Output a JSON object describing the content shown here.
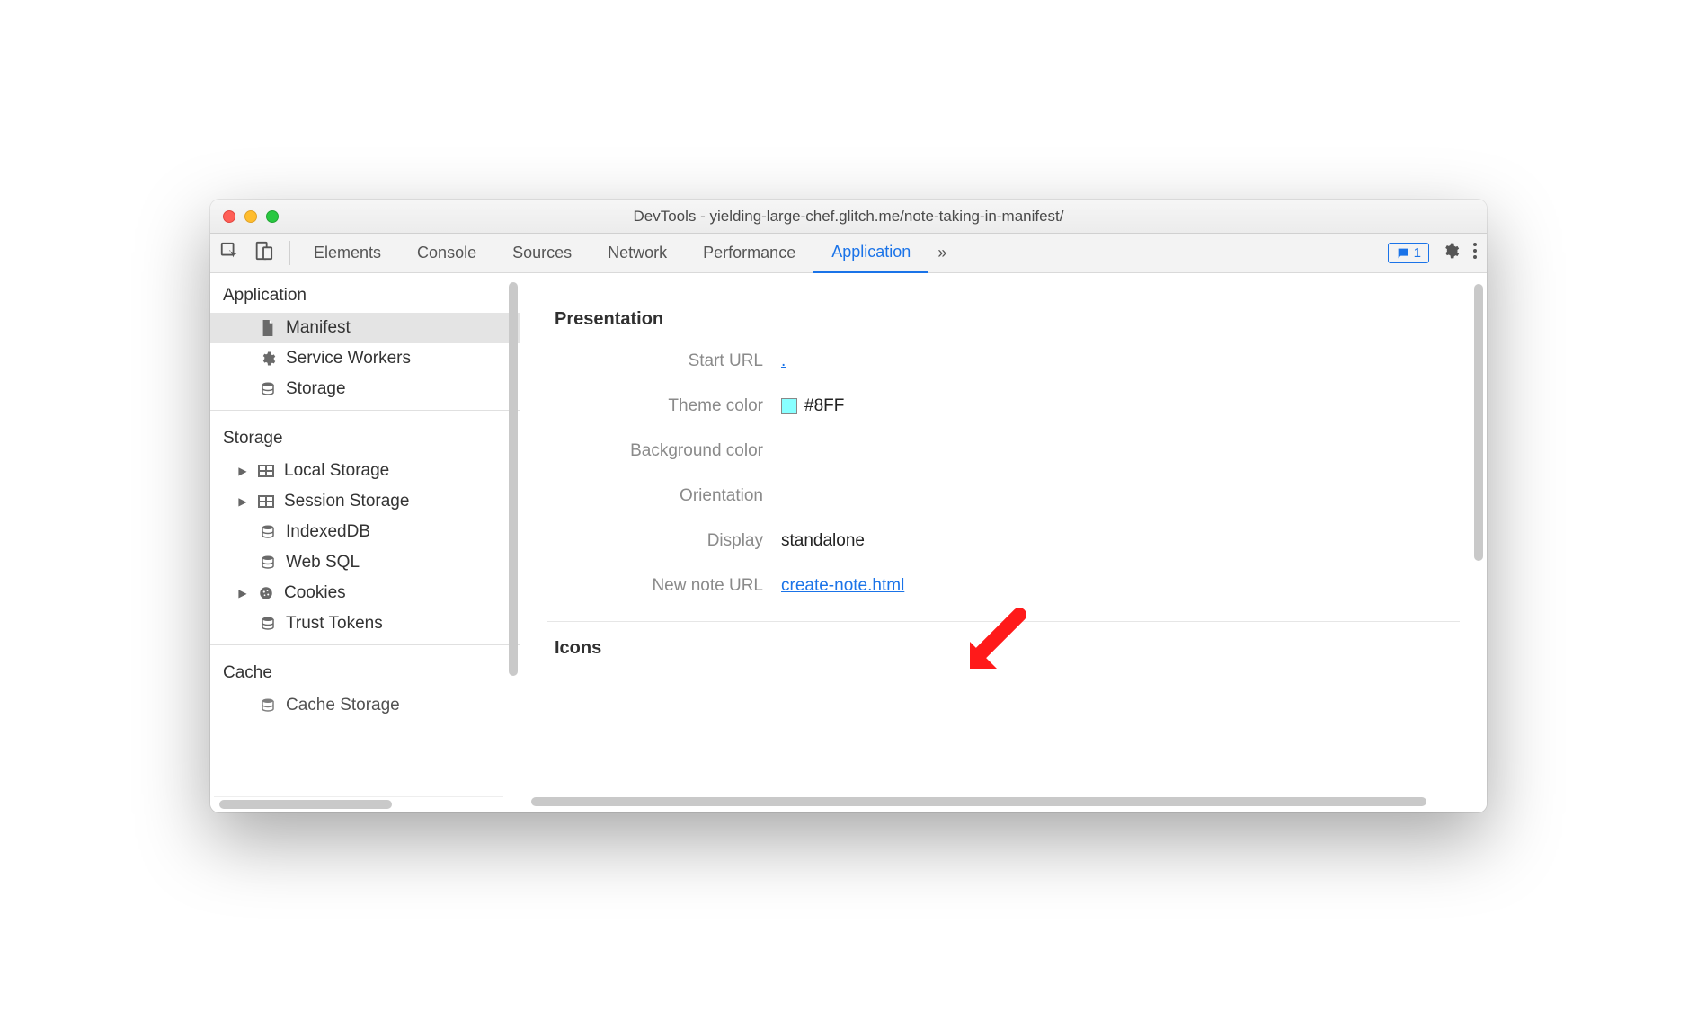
{
  "window": {
    "title": "DevTools - yielding-large-chef.glitch.me/note-taking-in-manifest/"
  },
  "toolbar": {
    "tabs": [
      "Elements",
      "Console",
      "Sources",
      "Network",
      "Performance",
      "Application"
    ],
    "active_tab": "Application",
    "more_glyph": "»",
    "issue_count": "1"
  },
  "sidebar": {
    "groups": [
      {
        "title": "Application",
        "items": [
          {
            "label": "Manifest",
            "icon": "file",
            "selected": true
          },
          {
            "label": "Service Workers",
            "icon": "gear"
          },
          {
            "label": "Storage",
            "icon": "db"
          }
        ]
      },
      {
        "title": "Storage",
        "items": [
          {
            "label": "Local Storage",
            "icon": "grid",
            "expandable": true
          },
          {
            "label": "Session Storage",
            "icon": "grid",
            "expandable": true
          },
          {
            "label": "IndexedDB",
            "icon": "db"
          },
          {
            "label": "Web SQL",
            "icon": "db"
          },
          {
            "label": "Cookies",
            "icon": "cookie",
            "expandable": true
          },
          {
            "label": "Trust Tokens",
            "icon": "db"
          }
        ]
      },
      {
        "title": "Cache",
        "items": [
          {
            "label": "Cache Storage",
            "icon": "db"
          }
        ]
      }
    ]
  },
  "main": {
    "section": "Presentation",
    "rows": {
      "start_url": {
        "label": "Start URL",
        "link": "."
      },
      "theme_color": {
        "label": "Theme color",
        "value": "#8FF",
        "swatch": "#88FFFF"
      },
      "background_color": {
        "label": "Background color",
        "value": ""
      },
      "orientation": {
        "label": "Orientation",
        "value": ""
      },
      "display": {
        "label": "Display",
        "value": "standalone"
      },
      "new_note_url": {
        "label": "New note URL",
        "link": "create-note.html"
      }
    },
    "next_section": "Icons"
  }
}
